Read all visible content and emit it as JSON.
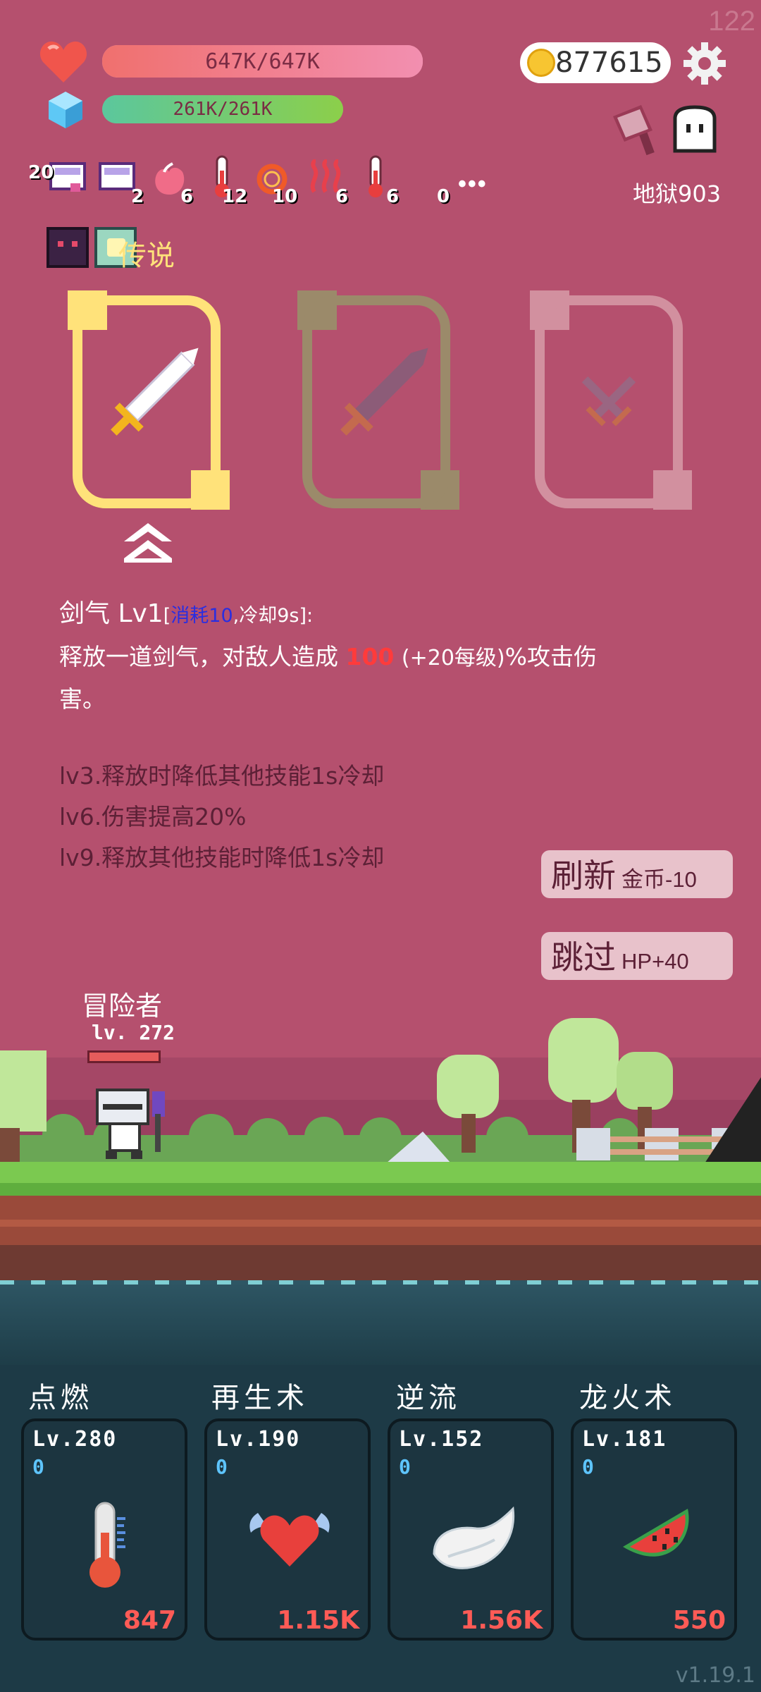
{
  "fps": "122",
  "hp": {
    "text": "647K/647K",
    "fill": 1.0
  },
  "mp": {
    "text": "261K/261K",
    "fill": 1.0
  },
  "gold": "877615",
  "stage": "地狱903",
  "status_effects": [
    {
      "icon": "scroll-icon",
      "count": "20"
    },
    {
      "icon": "scroll-icon",
      "count": "2"
    },
    {
      "icon": "peach-icon",
      "count": "6"
    },
    {
      "icon": "thermometer-icon",
      "count": "12"
    },
    {
      "icon": "fire-ring-icon",
      "count": "10"
    },
    {
      "icon": "heat-waves-icon",
      "count": "6"
    },
    {
      "icon": "thermometer-icon",
      "count": "6"
    },
    {
      "icon": "more-icon",
      "count": "0"
    }
  ],
  "rarity_label": "传说",
  "skill_detail": {
    "name_level": "剑气 Lv1",
    "bracket_open": "[",
    "cost": "消耗10",
    "cooldown": ",冷却9s]:",
    "line1_prefix": "释放一道剑气，对敌人造成",
    "damage": "100",
    "line1_suffix_a": "(+20每级)",
    "line1_suffix_b": "%攻击伤",
    "line2": "害。",
    "upgrades": [
      "lv3.释放时降低其他技能1s冷却",
      "lv6.伤害提高20%",
      "lv9.释放其他技能时降低1s冷却"
    ]
  },
  "refresh_button": {
    "label": "刷新",
    "sub": "金币-10"
  },
  "skip_button": {
    "label": "跳过",
    "sub": "HP+40"
  },
  "player": {
    "name": "冒险者",
    "level": "lv. 272"
  },
  "skills": [
    {
      "name": "点燃",
      "level": "Lv.280",
      "zero": "0",
      "cost": "847",
      "icon": "thermometer-icon"
    },
    {
      "name": "再生术",
      "level": "Lv.190",
      "zero": "0",
      "cost": "1.15K",
      "icon": "winged-heart-icon"
    },
    {
      "name": "逆流",
      "level": "Lv.152",
      "zero": "0",
      "cost": "1.56K",
      "icon": "wing-icon"
    },
    {
      "name": "龙火术",
      "level": "Lv.181",
      "zero": "0",
      "cost": "550",
      "icon": "watermelon-icon"
    }
  ],
  "version": "v1.19.1",
  "colors": {
    "accent_yellow": "#ffe27a",
    "damage_red": "#ff3b3b",
    "cost_blue": "#2a2ee0"
  }
}
